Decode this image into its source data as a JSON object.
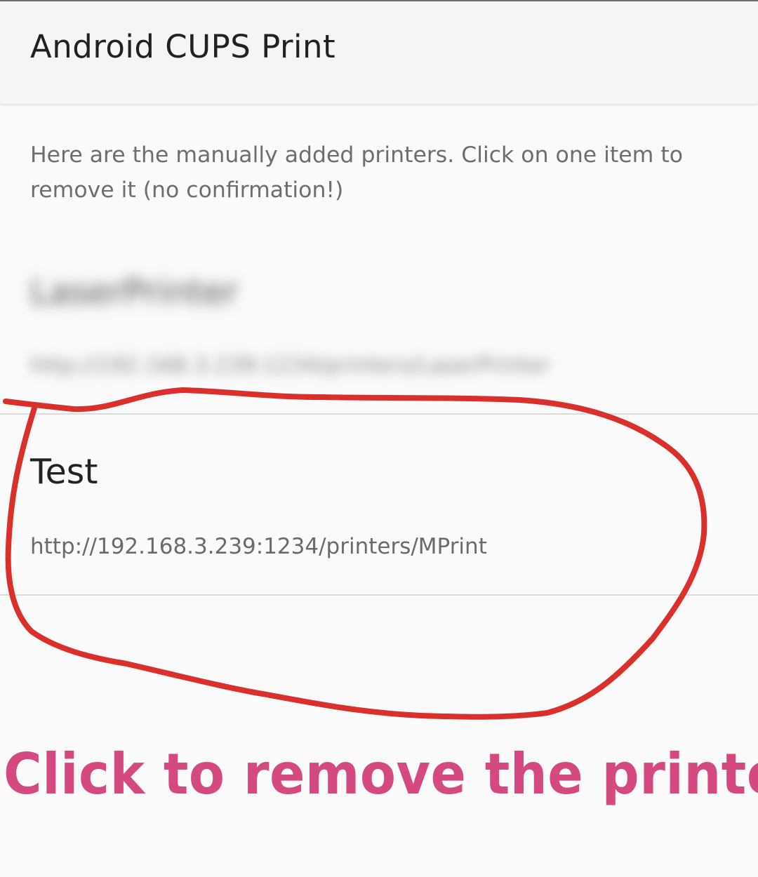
{
  "app_bar": {
    "title": "Android CUPS Print"
  },
  "intro": {
    "text": "Here are the manually added printers. Click on one item to remove it (no confirmation!)"
  },
  "printers": [
    {
      "name": "LaserPrinter",
      "url": "http://192.168.3.239:1234/printers/LaserPrinter"
    },
    {
      "name": "Test",
      "url": "http://192.168.3.239:1234/printers/MPrint"
    }
  ],
  "annotation": {
    "label": "Click to remove the printer",
    "stroke_color": "#d9302c",
    "text_color": "#d44a80"
  },
  "colors": {
    "background": "#fafafa",
    "app_bar": "#f5f5f5",
    "divider": "#dcdcdc"
  }
}
